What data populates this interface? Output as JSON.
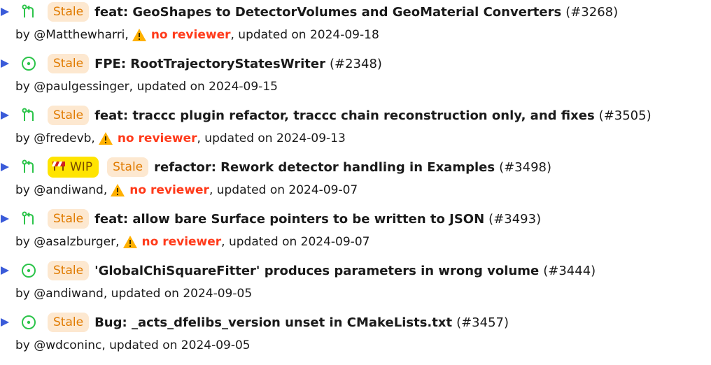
{
  "colors": {
    "stale_bg": "#fde8d0",
    "stale_fg": "#e07b00",
    "wip_bg": "#ffe400",
    "no_reviewer": "#ff3a1a",
    "icon_green": "#2cc44a",
    "expand_blue": "#3a5bd9",
    "warning_yellow": "#ffb000"
  },
  "items": [
    {
      "kind_icon": "pull-request-icon",
      "badge": "Stale",
      "title": "feat: GeoShapes to DetectorVolumes and GeoMaterial Converters",
      "number": "(#3268)",
      "by": "by @Matthewharri,",
      "no_reviewer": "no reviewer",
      "updated": ", updated on 2024-09-18"
    },
    {
      "kind_icon": "issue-icon",
      "badge": "Stale",
      "title": "FPE: RootTrajectoryStatesWriter",
      "number": "(#2348)",
      "by": "by @paulgessinger",
      "updated": ", updated on 2024-09-15"
    },
    {
      "kind_icon": "pull-request-icon",
      "badge": "Stale",
      "title": "feat: traccc plugin refactor, traccc chain reconstruction only, and fixes",
      "number": "(#3505)",
      "by": "by @fredevb,",
      "no_reviewer": "no reviewer",
      "updated": ", updated on 2024-09-13"
    },
    {
      "kind_icon": "pull-request-icon",
      "wip": "WIP",
      "badge": "Stale",
      "title": "refactor: Rework detector handling in Examples",
      "number": "(#3498)",
      "by": "by @andiwand,",
      "no_reviewer": "no reviewer",
      "updated": ", updated on 2024-09-07"
    },
    {
      "kind_icon": "pull-request-icon",
      "badge": "Stale",
      "title": "feat: allow bare Surface pointers to be written to JSON",
      "number": "(#3493)",
      "by": "by @asalzburger,",
      "no_reviewer": "no reviewer",
      "updated": ", updated on 2024-09-07"
    },
    {
      "kind_icon": "issue-icon",
      "badge": "Stale",
      "title": "'GlobalChiSquareFitter' produces parameters in wrong volume",
      "number": "(#3444)",
      "by": "by @andiwand",
      "updated": ", updated on 2024-09-05"
    },
    {
      "kind_icon": "issue-icon",
      "badge": "Stale",
      "title": "Bug: _acts_dfelibs_version unset in CMakeLists.txt",
      "number": "(#3457)",
      "by": "by @wdconinc",
      "updated": ", updated on 2024-09-05"
    }
  ]
}
